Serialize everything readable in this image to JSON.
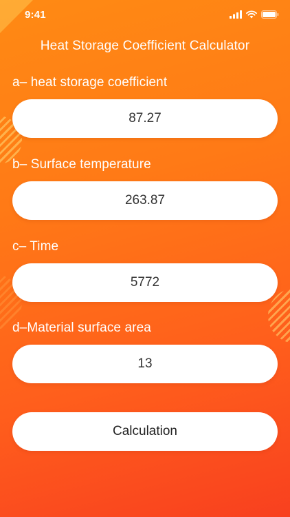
{
  "status_bar": {
    "time": "9:41"
  },
  "title": "Heat Storage Coefficient Calculator",
  "fields": [
    {
      "label": "a– heat storage coefficient",
      "value": "87.27"
    },
    {
      "label": "b– Surface temperature",
      "value": "263.87"
    },
    {
      "label": "c– Time",
      "value": "5772"
    },
    {
      "label": "d–Material surface area",
      "value": "13"
    }
  ],
  "button": {
    "label": "Calculation"
  },
  "colors": {
    "gradient_start": "#ff8a14",
    "gradient_end": "#f8401f",
    "field_background": "#ffffff",
    "field_text": "#333333"
  },
  "icons": {
    "signal": "cellular-signal-icon",
    "wifi": "wifi-icon",
    "battery": "battery-icon"
  }
}
